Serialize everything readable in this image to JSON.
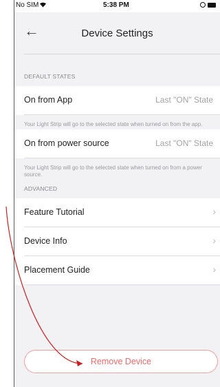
{
  "status_bar": {
    "carrier": "No SIM",
    "wifi_icon": "wifi-icon",
    "time": "5:38 PM"
  },
  "nav": {
    "back_icon": "left-arrow-icon",
    "title": "Device Settings"
  },
  "sections": {
    "default_states_header": "DEFAULT STATES",
    "advanced_header": "ADVANCED"
  },
  "default_states": {
    "on_from_app": {
      "label": "On from App",
      "value": "Last \"ON\" State"
    },
    "on_from_app_note": "Your Light Strip will go to the selected state when turned on from the app.",
    "on_from_power": {
      "label": "On from power source",
      "value": "Last \"ON\" State"
    },
    "on_from_power_note": "Your Light Strip will go to the selected state when turned on from a power source."
  },
  "advanced": {
    "feature_tutorial": "Feature Tutorial",
    "device_info": "Device Info",
    "placement_guide": "Placement Guide"
  },
  "actions": {
    "remove_device": "Remove Device"
  },
  "colors": {
    "accent_red": "#f26a6a",
    "annotation_red": "#cc1f1f"
  }
}
